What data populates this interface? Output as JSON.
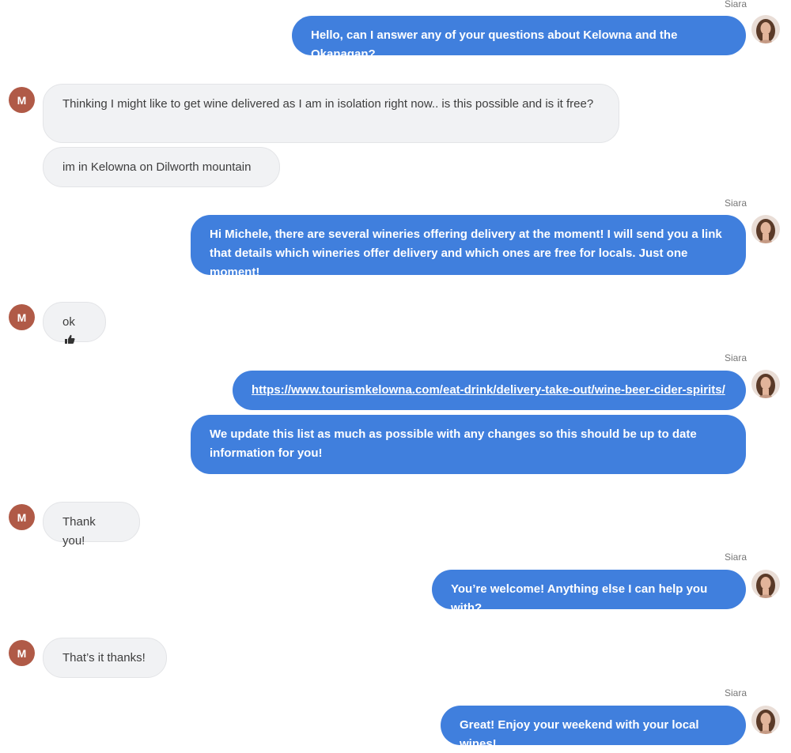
{
  "agent_name": "Siara",
  "user_initial": "M",
  "messages": {
    "m1": "Hello, can I answer any of your questions about Kelowna and the Okanagan?",
    "m2": "Thinking I might like to get wine delivered as I am in isolation right now.. is this possible and is it free?",
    "m3": "im in Kelowna on Dilworth mountain",
    "m4": "Hi Michele, there are several wineries offering delivery at the moment! I will send you a link that details which wineries offer delivery and which ones are free for locals. Just one moment!",
    "m5": "ok",
    "m6": "https://www.tourismkelowna.com/eat-drink/delivery-take-out/wine-beer-cider-spirits/",
    "m7": "We update this list as much as possible with any changes so this should be up to date information for you!",
    "m8": "Thank you!",
    "m9": "You’re welcome! Anything else I can help you with?",
    "m10": "That’s it thanks!",
    "m11": "Great! Enjoy your weekend with your local wines!"
  },
  "icons": {
    "m5_emoji": "thumbs-up-icon",
    "agent_avatar": "agent-avatar-photo"
  },
  "colors": {
    "agent_bubble": "#407fdd",
    "user_bubble": "#f1f2f4",
    "user_avatar": "#b05a47"
  }
}
